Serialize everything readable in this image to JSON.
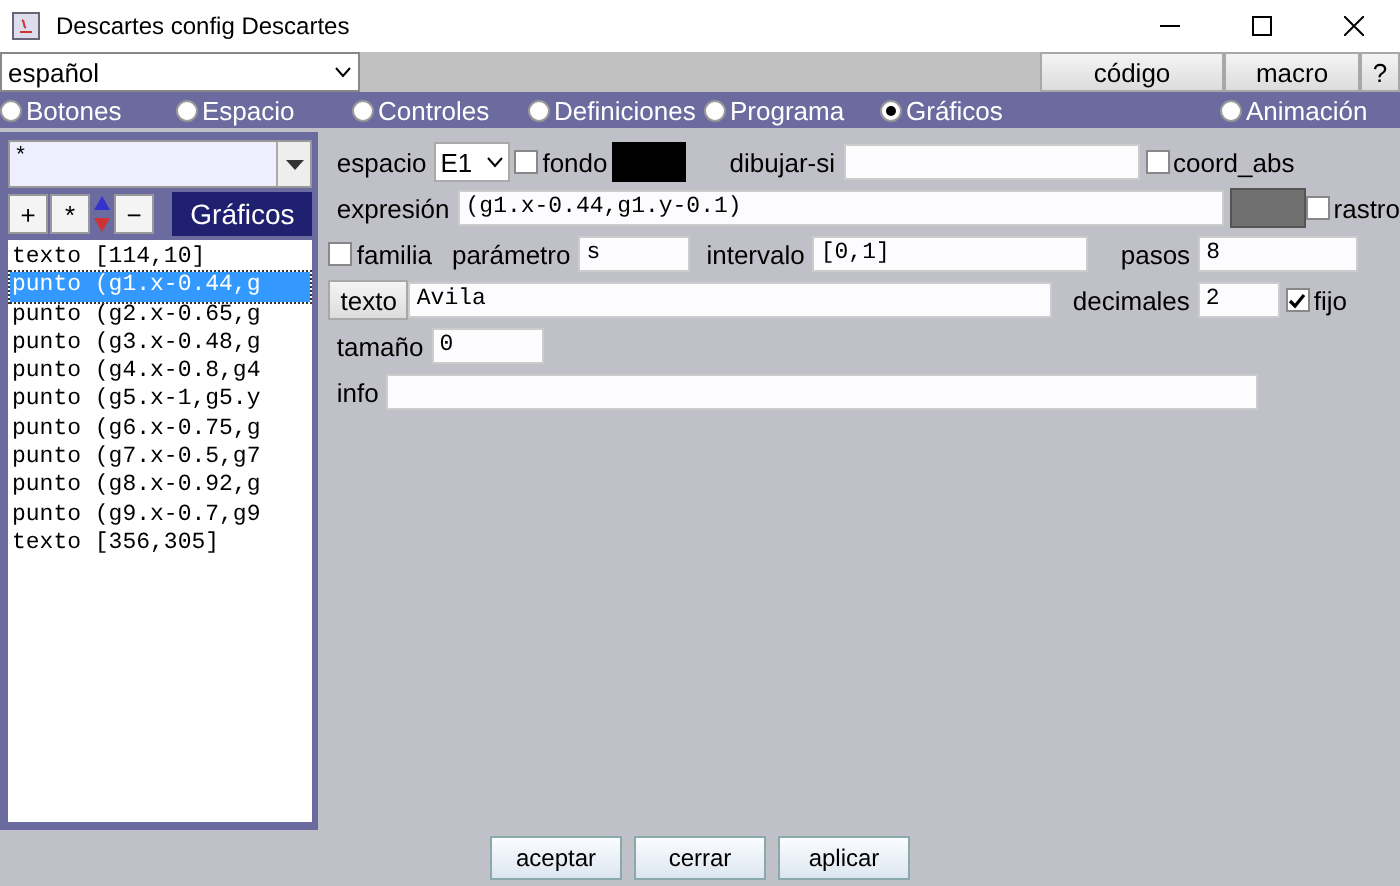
{
  "window": {
    "title": "Descartes config Descartes"
  },
  "language": {
    "value": "español"
  },
  "top_buttons": [
    "código",
    "macro",
    "?"
  ],
  "tabs": [
    {
      "label": "Botones",
      "selected": false
    },
    {
      "label": "Espacio",
      "selected": false
    },
    {
      "label": "Controles",
      "selected": false
    },
    {
      "label": "Definiciones",
      "selected": false
    },
    {
      "label": "Programa",
      "selected": false
    },
    {
      "label": "Gráficos",
      "selected": true
    },
    {
      "label": "Animación",
      "selected": false
    }
  ],
  "sidebar": {
    "filter": "*",
    "tool_buttons": [
      "+",
      "*",
      "−"
    ],
    "header": "Gráficos",
    "items": [
      {
        "label": "texto [114,10]",
        "selected": false
      },
      {
        "label": "punto (g1.x-0.44,g",
        "selected": true
      },
      {
        "label": "punto (g2.x-0.65,g",
        "selected": false
      },
      {
        "label": "punto (g3.x-0.48,g",
        "selected": false
      },
      {
        "label": "punto (g4.x-0.8,g4",
        "selected": false
      },
      {
        "label": "punto (g5.x-1,g5.y",
        "selected": false
      },
      {
        "label": "punto (g6.x-0.75,g",
        "selected": false
      },
      {
        "label": "punto (g7.x-0.5,g7",
        "selected": false
      },
      {
        "label": "punto (g8.x-0.92,g",
        "selected": false
      },
      {
        "label": "punto (g9.x-0.7,g9",
        "selected": false
      },
      {
        "label": "texto [356,305]",
        "selected": false
      }
    ]
  },
  "form": {
    "espacio": {
      "label": "espacio",
      "value": "E1"
    },
    "fondo": {
      "label": "fondo",
      "checked": false
    },
    "dibujar_si": {
      "label": "dibujar-si"
    },
    "coord_abs": {
      "label": "coord_abs",
      "checked": false
    },
    "expresion": {
      "label": "expresión",
      "value": "(g1.x-0.44,g1.y-0.1)"
    },
    "rastro": {
      "label": "rastro",
      "checked": false
    },
    "familia": {
      "label": "familia",
      "checked": false
    },
    "parametro": {
      "label": "parámetro",
      "value": "s"
    },
    "intervalo": {
      "label": "intervalo",
      "value": "[0,1]"
    },
    "pasos": {
      "label": "pasos",
      "value": "8"
    },
    "texto": {
      "button": "texto",
      "value": "Avila"
    },
    "decimales": {
      "label": "decimales",
      "value": "2"
    },
    "fijo": {
      "label": "fijo",
      "checked": true
    },
    "tamano": {
      "label": "tamaño",
      "value": "0"
    },
    "info": {
      "label": "info"
    }
  },
  "footer_buttons": [
    "aceptar",
    "cerrar",
    "aplicar"
  ]
}
